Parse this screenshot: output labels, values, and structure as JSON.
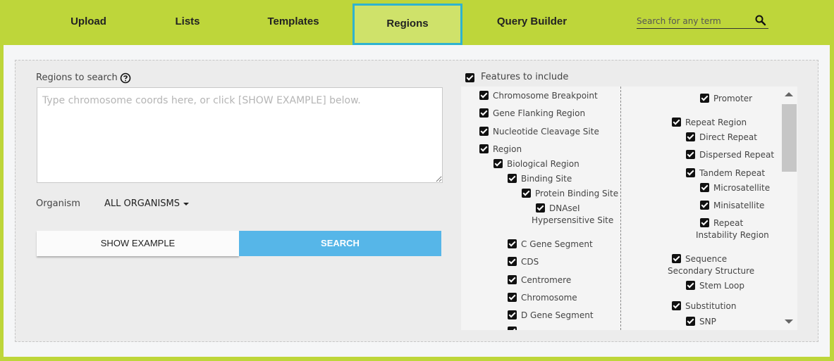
{
  "nav": {
    "items": [
      {
        "label": "Upload"
      },
      {
        "label": "Lists"
      },
      {
        "label": "Templates"
      },
      {
        "label": "Regions"
      },
      {
        "label": "Query Builder"
      }
    ],
    "search_placeholder": "Search for any term"
  },
  "regions": {
    "label": "Regions to search",
    "textarea_placeholder": "Type chromosome coords here, or click [SHOW EXAMPLE] below.",
    "organism_label": "Organism",
    "organism_value": "ALL ORGANISMS",
    "show_example_label": "SHOW EXAMPLE",
    "search_label": "SEARCH"
  },
  "features": {
    "header": "Features to include",
    "left": [
      "Chromosome Breakpoint",
      "Gene Flanking Region",
      "Nucleotide Cleavage Site",
      "Region",
      "Biological Region",
      "Binding Site",
      "Protein Binding Site",
      "DNAseI Hypersensitive Site",
      "C Gene Segment",
      "CDS",
      "Centromere",
      "Chromosome",
      "D Gene Segment"
    ],
    "right": [
      "Promoter",
      "Repeat Region",
      "Direct Repeat",
      "Dispersed Repeat",
      "Tandem Repeat",
      "Microsatellite",
      "Minisatellite",
      "Repeat Instability Region",
      "Sequence Secondary Structure",
      "Stem Loop",
      "Substitution",
      "SNP"
    ]
  },
  "colors": {
    "nav_bg": "#bed63a",
    "active_border": "#2fb3cf",
    "search_button": "#56b6e8"
  }
}
